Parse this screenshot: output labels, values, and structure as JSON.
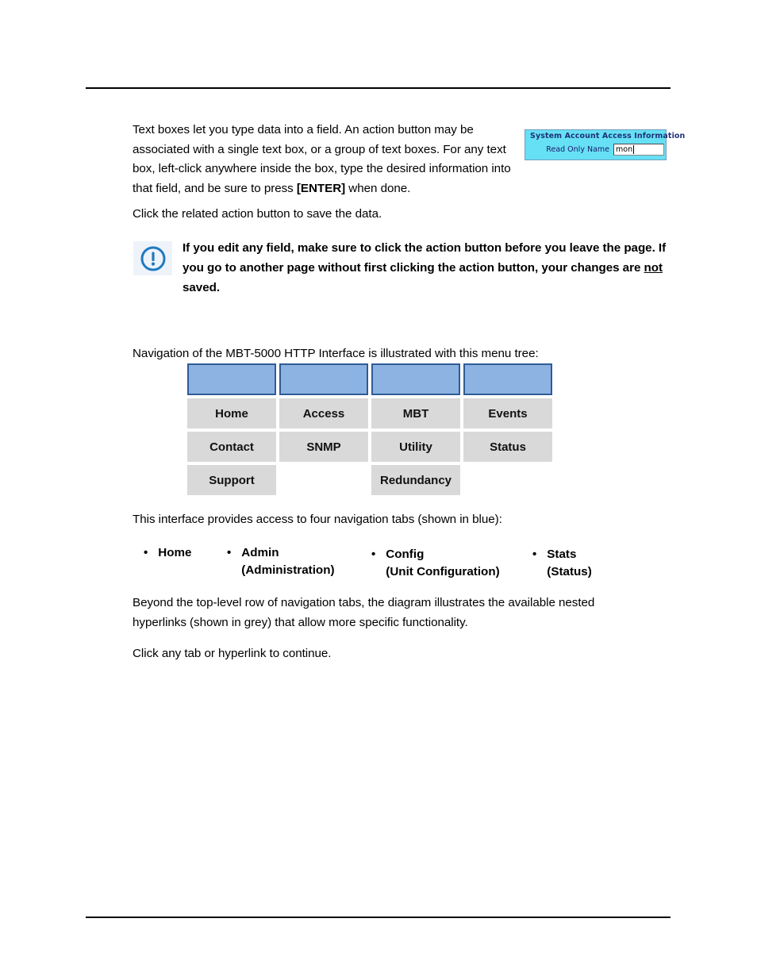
{
  "document": {
    "paragraphs": {
      "intro_1": "Text boxes let you type data into a field. An action button may be associated with a single text box, or a group of text boxes. For any text box, left-click anywhere inside the box, type the desired information into that field, and be sure to press ",
      "intro_1_bold": "[ENTER]",
      "intro_1_tail": " when done.",
      "save_data": "Click the related action button to save the data.",
      "nav_intro": "Navigation of the MBT-5000 HTTP Interface is illustrated with this menu tree:",
      "tabs_intro": "This interface provides access to four navigation tabs (shown in blue):",
      "beyond": "Beyond the top-level row of navigation tabs, the diagram illustrates the available nested hyperlinks (shown in grey) that allow more specific functionality.",
      "click_any": "Click any tab or hyperlink to continue."
    },
    "note": {
      "icon": "exclamation-circle-icon",
      "line_1": "If you edit any field, make sure to click the action button before you leave the page.",
      "line_2": "If you go to another page without first clicking the action button, your changes are ",
      "emphasis": "not",
      "line_2_tail": " saved."
    },
    "textbox_widget": {
      "title": "System Account Access Information",
      "field_label": "Read Only Name",
      "field_value": "mon",
      "field_placeholder": "",
      "header_bg": "#66E0F5",
      "title_color": "#1f3278"
    },
    "menu_tree": {
      "blue_color": "#8DB3E2",
      "blue_border": "#2E5C96",
      "grey_color": "#D9D9D9",
      "columns": [
        {
          "tab": "",
          "links": [
            "Home",
            "Contact",
            "Support"
          ]
        },
        {
          "tab": "",
          "links": [
            "Access",
            "SNMP",
            ""
          ]
        },
        {
          "tab": "",
          "links": [
            "MBT",
            "Utility",
            "Redundancy"
          ]
        },
        {
          "tab": "",
          "links": [
            "Events",
            "Status",
            ""
          ]
        }
      ]
    },
    "tabs_bullets": [
      {
        "name": "Home",
        "sub": ""
      },
      {
        "name": "Admin",
        "sub": "(Administration)"
      },
      {
        "name": "Config",
        "sub": "(Unit Configuration)"
      },
      {
        "name": "Stats",
        "sub": "(Status)"
      }
    ]
  }
}
